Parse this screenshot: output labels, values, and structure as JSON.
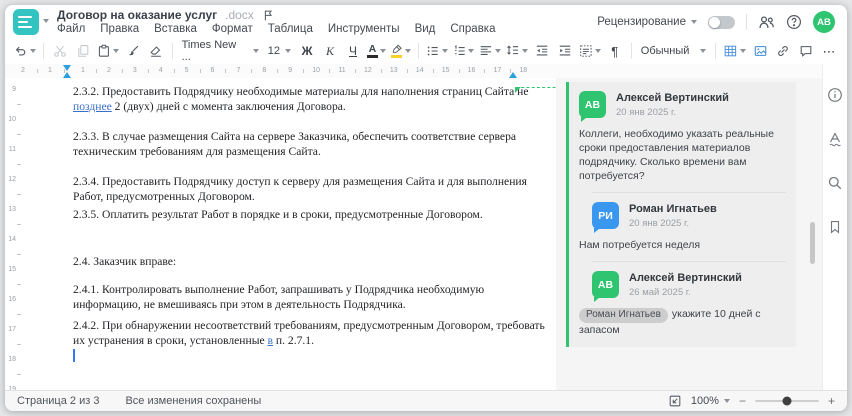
{
  "window": {
    "title": "Договор на оказание услуг",
    "title_ext": ".docx"
  },
  "menu": {
    "items": [
      "Файл",
      "Правка",
      "Вставка",
      "Формат",
      "Таблица",
      "Инструменты",
      "Вид",
      "Справка"
    ]
  },
  "topbar": {
    "review_label": "Рецензирование",
    "avatar_initials": "АВ"
  },
  "toolbar": {
    "font_name": "Times New ...",
    "font_size": "12",
    "bold": "Ж",
    "italic": "К",
    "underline": "Ч",
    "font_color_letter": "А",
    "style_name": "Обычный",
    "pilcrow": "¶",
    "more": "⋯"
  },
  "ruler": {
    "h_margin": [
      "2",
      "1"
    ],
    "h_main": [
      "1",
      "2",
      "3",
      "4",
      "5",
      "6",
      "7",
      "8",
      "9",
      "10",
      "11",
      "12",
      "13",
      "14",
      "15",
      "16",
      "17",
      "18"
    ],
    "v": [
      "9",
      "10",
      "11",
      "12",
      "13",
      "14",
      "15",
      "16",
      "17",
      "18",
      "19"
    ]
  },
  "document": {
    "p232_l1": "2.3.2. Предоставить Подрядчику необходимые материалы для наполнения страниц Сайта не",
    "p232_ins": "позднее",
    "p232_l2": " 2 (двух) дней с момента заключения Договора.",
    "p233_l1": "2.3.3. В случае размещения Сайта на сервере Заказчика, обеспечить соответствие сервера",
    "p233_l2": "техническим требованиям для размещения Сайта.",
    "p234_l1": "2.3.4. Предоставить Подрядчику доступ к серверу для размещения Сайта и для выполнения",
    "p234_l2": "Работ, предусмотренных Договором.",
    "p235": "2.3.5. Оплатить результат Работ в порядке и в сроки, предусмотренные Договором.",
    "p24": "2.4. Заказчик вправе:",
    "p241_l1": "2.4.1. Контролировать выполнение Работ, запрашивать у Подрядчика необходимую",
    "p241_l2": "информацию, не вмешиваясь при этом в деятельность Подрядчика.",
    "p242_l1": "2.4.2. При обнаружении несоответствий требованиям, предусмотренным Договором, требовать",
    "p242_l2a": "их устранения в сроки, установленные ",
    "p242_ins": "в",
    "p242_l2b": " п. 2.7.1."
  },
  "comments": {
    "c1": {
      "initials": "АВ",
      "name": "Алексей Вертинский",
      "date": "20 янв 2025 г.",
      "text": "Коллеги, необходимо указать реальные сроки предоставления материалов подрядчику. Сколько времени вам потребуется?"
    },
    "c2": {
      "initials": "РИ",
      "name": "Роман Игнатьев",
      "date": "20 янв 2025 г.",
      "text": "Нам потребуется неделя"
    },
    "c3": {
      "initials": "АВ",
      "name": "Алексей Вертинский",
      "date": "26 май 2025 г.",
      "mention": "Роман Игнатьев",
      "text": "укажите 10 дней с запасом"
    }
  },
  "statusbar": {
    "page_info": "Страница 2 из 3",
    "save_status": "Все изменения сохранены",
    "zoom_level": "100%"
  },
  "colors": {
    "accent_green": "#2fc46f",
    "avatar_blue": "#3a97f0",
    "logo_teal": "#33c3c0",
    "insert_blue": "#3b6fc9"
  }
}
